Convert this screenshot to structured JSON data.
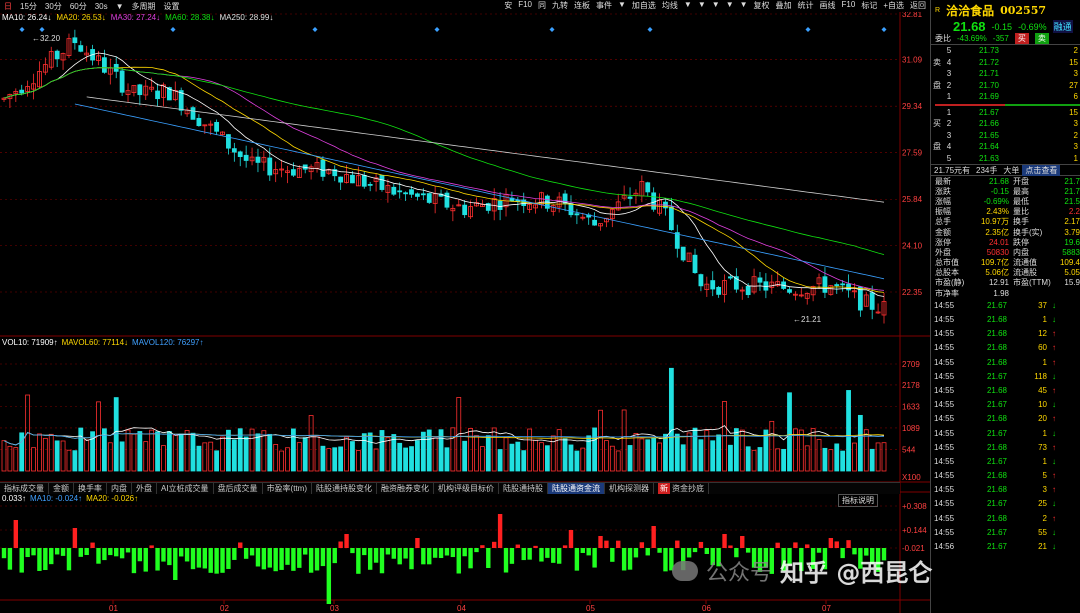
{
  "toolbar": {
    "items": [
      "日",
      "15分",
      "30分",
      "60分",
      "30s",
      "▼",
      "多周期",
      "设置"
    ],
    "right_items": [
      "安",
      "F10",
      "同",
      "九转",
      "连板",
      "事件",
      "▼",
      "加自选",
      "均线",
      "▼",
      "▼",
      "▼",
      "▼",
      "▼",
      "复权",
      "叠加",
      "统计",
      "画线",
      "F10",
      "标记",
      "+自选",
      "返回"
    ]
  },
  "ma_legend": [
    {
      "label": "MA10: 26.24↓",
      "color": "#ffffff"
    },
    {
      "label": "MA20: 26.53↓",
      "color": "#ffd800"
    },
    {
      "label": "MA30: 27.24↓",
      "color": "#e040e0"
    },
    {
      "label": "MA60: 28.38↓",
      "color": "#10e010"
    },
    {
      "label": "MA250: 28.99↓",
      "color": "#e0e0e0"
    }
  ],
  "price_axis": [
    "32.81",
    "31.09",
    "29.34",
    "27.59",
    "25.84",
    "24.10",
    "22.35"
  ],
  "price_annotations": {
    "high": "32.20",
    "low": "21.21"
  },
  "vol_axis": [
    "2709",
    "2178",
    "1633",
    "1089",
    "544",
    "X100"
  ],
  "vol_legend": [
    {
      "label": "VOL10: 71909↑",
      "color": "#ffffff"
    },
    {
      "label": "MAVOL60: 77114↓",
      "color": "#ffd800"
    },
    {
      "label": "MAVOL120: 76297↑",
      "color": "#40a0ff"
    }
  ],
  "indicator_tabs": [
    "指标成交量",
    "金额",
    "换手率",
    "内盘",
    "外盘",
    "AI立桩成交量",
    "盘后成交量",
    "市盈率(ttm)",
    "陆股通持股变化",
    "融资融券变化",
    "机构评级目标价",
    "陆股通持股",
    "陆股通资金流",
    "机构探测器",
    "资金抄底"
  ],
  "indicator_tab_badge": "新",
  "ind_legend": [
    {
      "label": "0.033↑",
      "color": "#ffffff"
    },
    {
      "label": "MA10: -0.024↑",
      "color": "#40a0ff"
    },
    {
      "label": "MA20: -0.026↑",
      "color": "#ffd800"
    }
  ],
  "ind_help": "指标说明",
  "ind_axis": [
    "+0.308",
    "+0.144",
    "-0.021"
  ],
  "x_axis": [
    "01",
    "02",
    "03",
    "04",
    "05",
    "06",
    "07"
  ],
  "stock": {
    "name": "洽洽食品",
    "code": "002557",
    "price": "21.68",
    "change": "-0.15",
    "pct": "-0.69%",
    "tag": "融通",
    "webi_label": "委比",
    "webi": "-43.69%",
    "webi_diff": "-357",
    "buy_btn": "买",
    "sell_btn": "卖"
  },
  "sell_label": "卖盘",
  "buy_label": "买盘",
  "sells": [
    {
      "lvl": "5",
      "price": "21.73",
      "vol": "2"
    },
    {
      "lvl": "4",
      "price": "21.72",
      "vol": "15"
    },
    {
      "lvl": "3",
      "price": "21.71",
      "vol": "3"
    },
    {
      "lvl": "2",
      "price": "21.70",
      "vol": "27"
    },
    {
      "lvl": "1",
      "price": "21.69",
      "vol": "6"
    }
  ],
  "buys": [
    {
      "lvl": "1",
      "price": "21.67",
      "vol": "15"
    },
    {
      "lvl": "2",
      "price": "21.66",
      "vol": "3"
    },
    {
      "lvl": "3",
      "price": "21.65",
      "vol": "2"
    },
    {
      "lvl": "4",
      "price": "21.64",
      "vol": "3"
    },
    {
      "lvl": "5",
      "price": "21.63",
      "vol": "1"
    }
  ],
  "rp_tabs": [
    "21.75元有",
    "234手",
    "大单",
    "点击查看"
  ],
  "stats": [
    {
      "l1": "最新",
      "v1": "21.68",
      "c1": "green",
      "l2": "开盘",
      "v2": "21.7",
      "c2": "green"
    },
    {
      "l1": "涨跌",
      "v1": "-0.15",
      "c1": "green",
      "l2": "最高",
      "v2": "21.7",
      "c2": "green"
    },
    {
      "l1": "涨幅",
      "v1": "-0.69%",
      "c1": "green",
      "l2": "最低",
      "v2": "21.5",
      "c2": "green"
    },
    {
      "l1": "振幅",
      "v1": "2.43%",
      "c1": "yellow",
      "l2": "量比",
      "v2": "2.2",
      "c2": "red"
    },
    {
      "l1": "总手",
      "v1": "10.97万",
      "c1": "yellow",
      "l2": "换手",
      "v2": "2.17",
      "c2": "yellow"
    },
    {
      "l1": "金额",
      "v1": "2.35亿",
      "c1": "yellow",
      "l2": "换手(实)",
      "v2": "3.79",
      "c2": "yellow"
    },
    {
      "l1": "涨停",
      "v1": "24.01",
      "c1": "red",
      "l2": "跌停",
      "v2": "19.6",
      "c2": "green"
    },
    {
      "l1": "外盘",
      "v1": "50830",
      "c1": "red",
      "l2": "内盘",
      "v2": "5883",
      "c2": "green"
    },
    {
      "l1": "总市值",
      "v1": "109.7亿",
      "c1": "yellow",
      "l2": "流通值",
      "v2": "109.4",
      "c2": "yellow"
    },
    {
      "l1": "总股本",
      "v1": "5.06亿",
      "c1": "yellow",
      "l2": "流通股",
      "v2": "5.05",
      "c2": "yellow"
    },
    {
      "l1": "市盈(静)",
      "v1": "12.91",
      "c1": "white",
      "l2": "市盈(TTM)",
      "v2": "15.9",
      "c2": "white"
    },
    {
      "l1": "市净率",
      "v1": "1.98",
      "c1": "white",
      "l2": "",
      "v2": "",
      "c2": "white"
    }
  ],
  "ticks": [
    {
      "t": "14:55",
      "p": "21.67",
      "pc": "green",
      "v": "37",
      "d": "down"
    },
    {
      "t": "14:55",
      "p": "21.68",
      "pc": "green",
      "v": "1",
      "d": "down"
    },
    {
      "t": "14:55",
      "p": "21.68",
      "pc": "green",
      "v": "12",
      "d": "up"
    },
    {
      "t": "14:55",
      "p": "21.68",
      "pc": "green",
      "v": "60",
      "d": "up"
    },
    {
      "t": "14:55",
      "p": "21.68",
      "pc": "green",
      "v": "1",
      "d": "up"
    },
    {
      "t": "14:55",
      "p": "21.67",
      "pc": "green",
      "v": "118",
      "d": "down"
    },
    {
      "t": "14:55",
      "p": "21.68",
      "pc": "green",
      "v": "45",
      "d": "up"
    },
    {
      "t": "14:55",
      "p": "21.67",
      "pc": "green",
      "v": "10",
      "d": "down"
    },
    {
      "t": "14:55",
      "p": "21.68",
      "pc": "green",
      "v": "20",
      "d": "up"
    },
    {
      "t": "14:55",
      "p": "21.67",
      "pc": "green",
      "v": "1",
      "d": "down"
    },
    {
      "t": "14:55",
      "p": "21.68",
      "pc": "green",
      "v": "73",
      "d": "up"
    },
    {
      "t": "14:55",
      "p": "21.67",
      "pc": "green",
      "v": "1",
      "d": "down"
    },
    {
      "t": "14:55",
      "p": "21.68",
      "pc": "green",
      "v": "5",
      "d": "up"
    },
    {
      "t": "14:55",
      "p": "21.68",
      "pc": "green",
      "v": "3",
      "d": "up"
    },
    {
      "t": "14:55",
      "p": "21.67",
      "pc": "green",
      "v": "25",
      "d": "down"
    },
    {
      "t": "14:55",
      "p": "21.68",
      "pc": "green",
      "v": "2",
      "d": "up"
    },
    {
      "t": "14:55",
      "p": "21.67",
      "pc": "green",
      "v": "55",
      "d": "down"
    },
    {
      "t": "14:56",
      "p": "21.67",
      "pc": "green",
      "v": "21",
      "d": "down"
    }
  ],
  "watermark": {
    "left": "公众号",
    "right": "知乎 @西昆仑"
  },
  "colors": {
    "up": "#ff3030",
    "down": "#20e0e0",
    "bg": "#000000",
    "grid": "#800000"
  }
}
